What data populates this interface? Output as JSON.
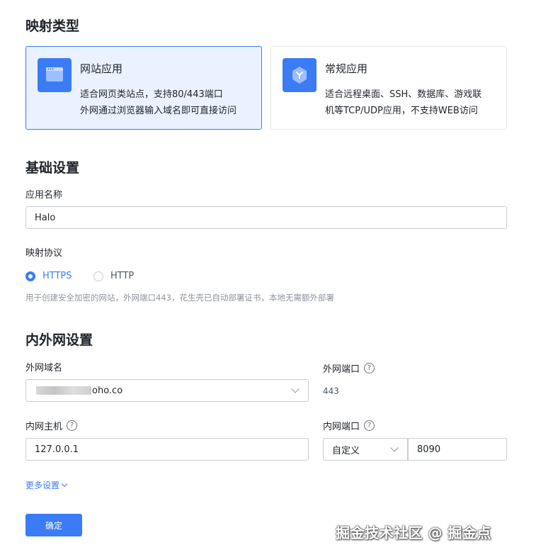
{
  "mapping_type": {
    "title": "映射类型",
    "cards": [
      {
        "title": "网站应用",
        "desc_line1": "适合网页类站点，支持80/443端口",
        "desc_line2": "外网通过浏览器输入域名即可直接访问",
        "icon": "browser-window-icon",
        "selected": true
      },
      {
        "title": "常规应用",
        "desc_line1": "适合远程桌面、SSH、数据库、游戏联",
        "desc_line2": "机等TCP/UDP应用，不支持WEB访问",
        "icon": "cube-icon",
        "selected": false
      }
    ]
  },
  "basic": {
    "title": "基础设置",
    "app_name_label": "应用名称",
    "app_name_value": "Halo",
    "protocol_label": "映射协议",
    "protocol_options": [
      "HTTPS",
      "HTTP"
    ],
    "protocol_selected": "HTTPS",
    "protocol_hint": "用于创建安全加密的网站，外网端口443，花生壳已自动部署证书，本地无需额外部署"
  },
  "network": {
    "title": "内外网设置",
    "domain_label": "外网域名",
    "domain_value_suffix": "oho.co",
    "ext_port_label": "外网端口",
    "ext_port_value": "443",
    "host_label": "内网主机",
    "host_value": "127.0.0.1",
    "int_port_label": "内网端口",
    "int_port_mode": "自定义",
    "int_port_value": "8090",
    "help_symbol": "?"
  },
  "more_settings": "更多设置",
  "confirm_label": "确定",
  "watermark": "掘金技术社区 @ 掘金点",
  "colors": {
    "accent": "#3b7cf6",
    "selected_bg": "#eaf2ff",
    "border": "#c9cdd4"
  }
}
